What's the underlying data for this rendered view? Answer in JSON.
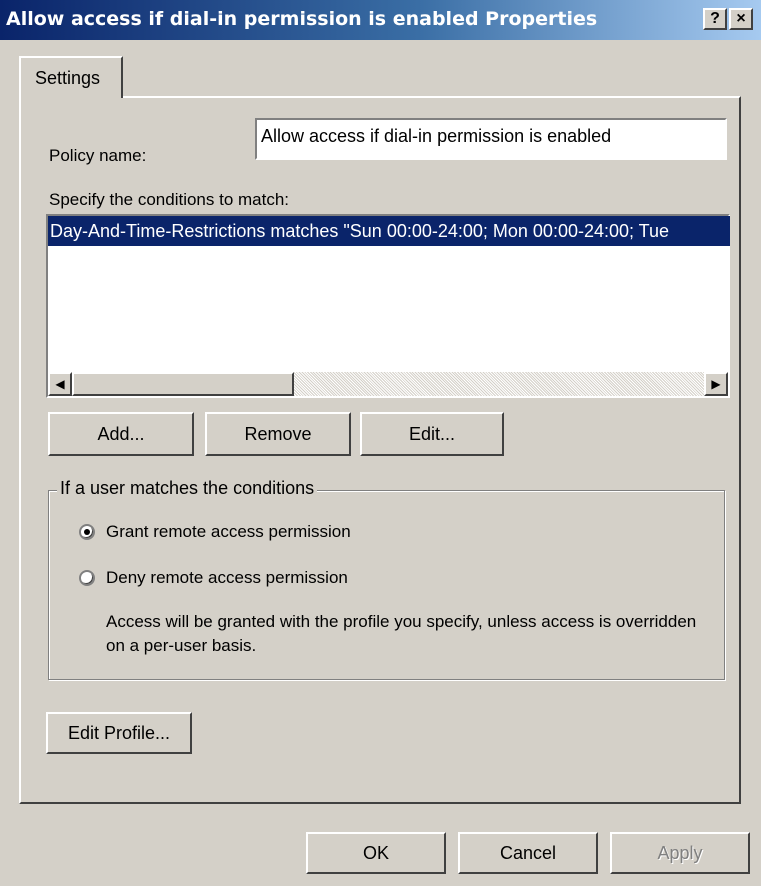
{
  "window": {
    "title": "Allow access if dial-in permission is enabled Properties",
    "help_button": "?",
    "close_button": "×"
  },
  "tabs": [
    {
      "label": "Settings"
    }
  ],
  "policy": {
    "name_label": "Policy name:",
    "name_value": "Allow access if dial-in permission is enabled"
  },
  "conditions": {
    "label": "Specify the conditions to match:",
    "items": [
      "Day-And-Time-Restrictions matches \"Sun 00:00-24:00; Mon 00:00-24:00; Tue"
    ],
    "buttons": {
      "add": "Add...",
      "remove": "Remove",
      "edit": "Edit..."
    }
  },
  "user_match": {
    "legend": "If a user matches the conditions",
    "grant_label": "Grant remote access permission",
    "deny_label": "Deny remote access permission",
    "selected": "grant",
    "note": "Access will be granted with the profile you specify, unless access is overridden on a per-user basis."
  },
  "edit_profile": "Edit Profile...",
  "footer": {
    "ok": "OK",
    "cancel": "Cancel",
    "apply": "Apply"
  },
  "colors": {
    "title_start": "#0a246a",
    "title_end": "#a6caf0",
    "face": "#d4d0c8",
    "selection": "#0a246a"
  }
}
